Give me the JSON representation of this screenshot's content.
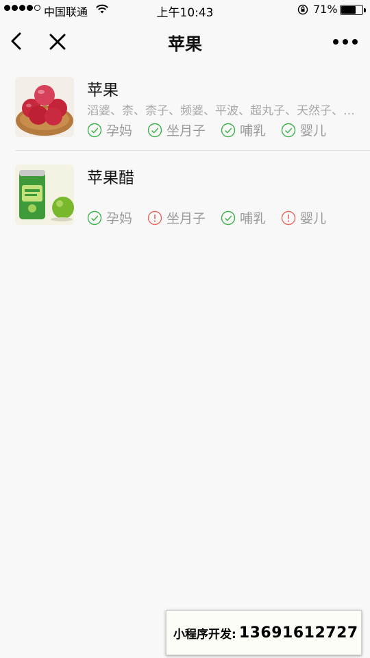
{
  "status_bar": {
    "carrier": "中国联通",
    "time": "上午10:43",
    "battery_percent_text": "71%",
    "battery_level": 0.71
  },
  "nav": {
    "title": "苹果"
  },
  "items": [
    {
      "name": "苹果",
      "alias": "滔婆、柰、柰子、频婆、平波、超丸子、天然子、智慧果",
      "tags": [
        {
          "label": "孕妈",
          "status": "ok"
        },
        {
          "label": "坐月子",
          "status": "ok"
        },
        {
          "label": "哺乳",
          "status": "ok"
        },
        {
          "label": "婴儿",
          "status": "ok"
        }
      ]
    },
    {
      "name": "苹果醋",
      "alias": "",
      "tags": [
        {
          "label": "孕妈",
          "status": "ok"
        },
        {
          "label": "坐月子",
          "status": "warn"
        },
        {
          "label": "哺乳",
          "status": "ok"
        },
        {
          "label": "婴儿",
          "status": "warn"
        }
      ]
    }
  ],
  "footer": {
    "label": "小程序开发:",
    "phone": "13691612727"
  },
  "colors": {
    "ok": "#3cb24a",
    "warn": "#e86a5f"
  }
}
